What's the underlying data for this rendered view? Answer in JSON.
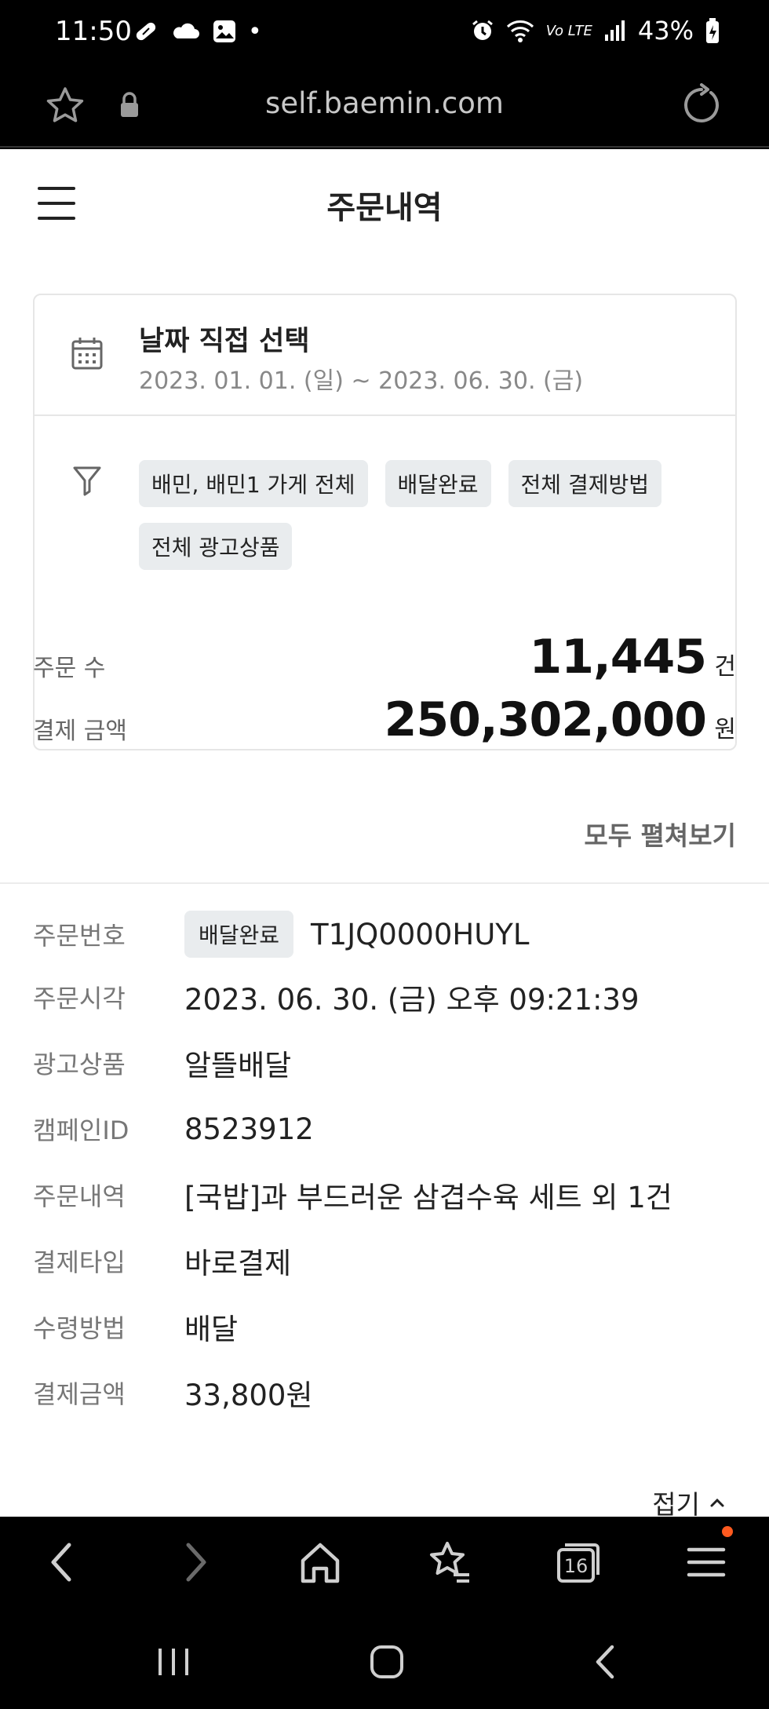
{
  "status_bar": {
    "time": "11:50",
    "notification_dot": "•",
    "battery": "43%",
    "network": "Vo LTE"
  },
  "browser": {
    "url": "self.baemin.com",
    "tabs_count": "16"
  },
  "header": {
    "title": "주문내역"
  },
  "filters": {
    "date_title": "날짜 직접 선택",
    "date_range": "2023. 01. 01. (일) ~ 2023. 06. 30. (금)",
    "chips": [
      "배민, 배민1 가게 전체",
      "배달완료",
      "전체 결제방법",
      "전체 광고상품"
    ]
  },
  "summary": {
    "order_count_label": "주문 수",
    "order_count": "11,445",
    "order_count_unit": "건",
    "payment_label": "결제 금액",
    "payment_amount": "250,302,000",
    "payment_unit": "원",
    "expand_all": "모두 펼쳐보기"
  },
  "order": {
    "order_no_label": "주문번호",
    "status": "배달완료",
    "order_no": "T1JQ0000HUYL",
    "order_time_label": "주문시각",
    "order_time": "2023. 06. 30. (금) 오후 09:21:39",
    "ad_product_label": "광고상품",
    "ad_product": "알뜰배달",
    "campaign_label": "캠페인ID",
    "campaign_id": "8523912",
    "items_label": "주문내역",
    "items": "[국밥]과 부드러운 삼겹수육 세트 외 1건",
    "payment_type_label": "결제타입",
    "payment_type": "바로결제",
    "delivery_method_label": "수령방법",
    "delivery_method": "배달",
    "amount_label": "결제금액",
    "amount": "33,800원",
    "collapse": "접기"
  },
  "colors": {
    "chip_bg": "#e9ecee",
    "muted_text": "#777777",
    "notification_dot": "#ff5a1f"
  }
}
